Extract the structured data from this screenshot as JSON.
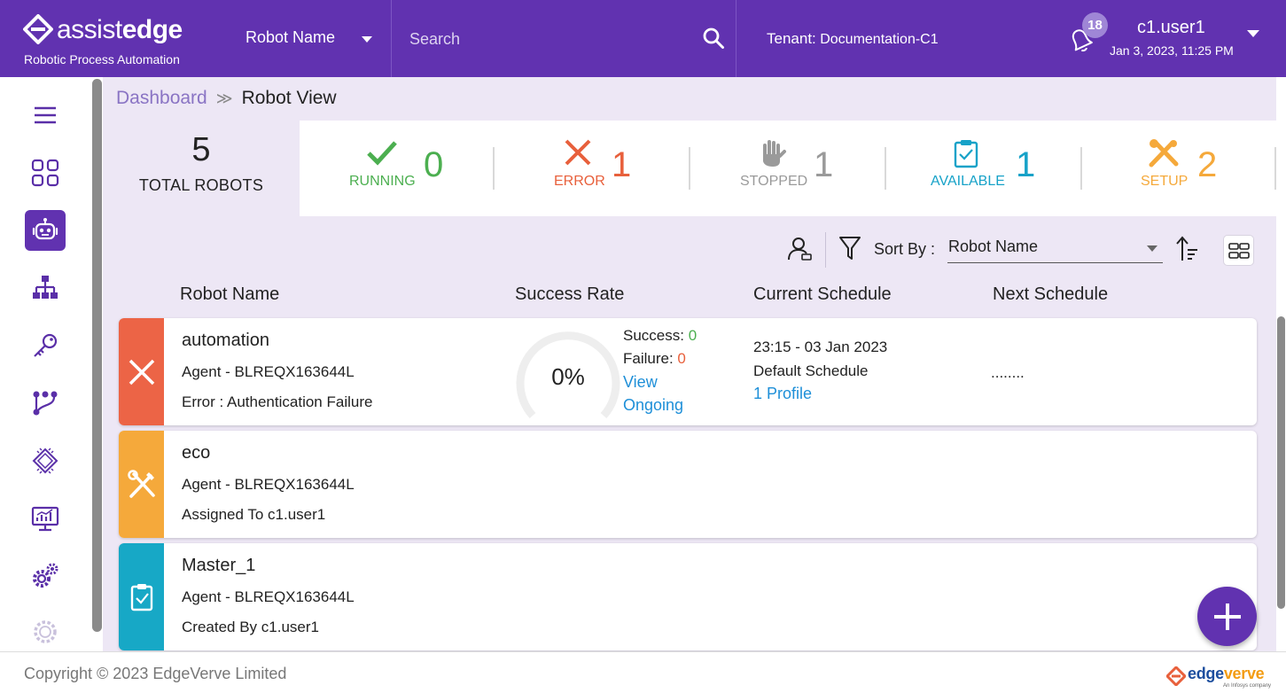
{
  "header": {
    "logo_part1": "assist",
    "logo_part2": "edge",
    "logo_subtitle": "Robotic Process Automation",
    "robot_selector": "Robot Name",
    "search_placeholder": "Search",
    "tenant_label": "Tenant:",
    "tenant_value": "Documentation-C1",
    "notification_count": "18",
    "username": "c1.user1",
    "datetime": "Jan 3, 2023, 11:25 PM"
  },
  "breadcrumb": {
    "dashboard": "Dashboard",
    "separator": "≫",
    "current": "Robot View"
  },
  "summary": {
    "total_count": "5",
    "total_label": "TOTAL ROBOTS",
    "stats": [
      {
        "label": "RUNNING",
        "count": "0",
        "color": "#4caf50"
      },
      {
        "label": "ERROR",
        "count": "1",
        "color": "#e8603c"
      },
      {
        "label": "STOPPED",
        "count": "1",
        "color": "#9a9a9a"
      },
      {
        "label": "AVAILABLE",
        "count": "1",
        "color": "#17a2c8"
      },
      {
        "label": "SETUP",
        "count": "2",
        "color": "#f5a93b"
      }
    ]
  },
  "toolbar": {
    "sort_label": "Sort By :",
    "sort_value": "Robot Name"
  },
  "columns": {
    "robot_name": "Robot Name",
    "success_rate": "Success Rate",
    "current_schedule": "Current Schedule",
    "next_schedule": "Next Schedule"
  },
  "robots": [
    {
      "name": "automation",
      "agent": "Agent - BLREQX163644L",
      "info": "Error : Authentication Failure",
      "status_color": "#ec6446",
      "success_rate": "0%",
      "success_label": "Success:",
      "success_value": "0",
      "failure_label": "Failure:",
      "failure_value": "0",
      "view_link": "View",
      "ongoing_link": "Ongoing",
      "schedule_time": "23:15 - 03 Jan 2023",
      "schedule_name": "Default Schedule",
      "schedule_profile": "1 Profile",
      "next_schedule": "........"
    },
    {
      "name": "eco",
      "agent": "Agent - BLREQX163644L",
      "info": "Assigned To c1.user1",
      "status_color": "#f5a93b"
    },
    {
      "name": "Master_1",
      "agent": "Agent - BLREQX163644L",
      "info": "Created By c1.user1",
      "status_color": "#17a8c6"
    }
  ],
  "footer": {
    "copyright": "Copyright © 2023 EdgeVerve Limited",
    "brand_part1": "edge",
    "brand_part2": "verve",
    "brand_sub": "An Infosys company"
  }
}
